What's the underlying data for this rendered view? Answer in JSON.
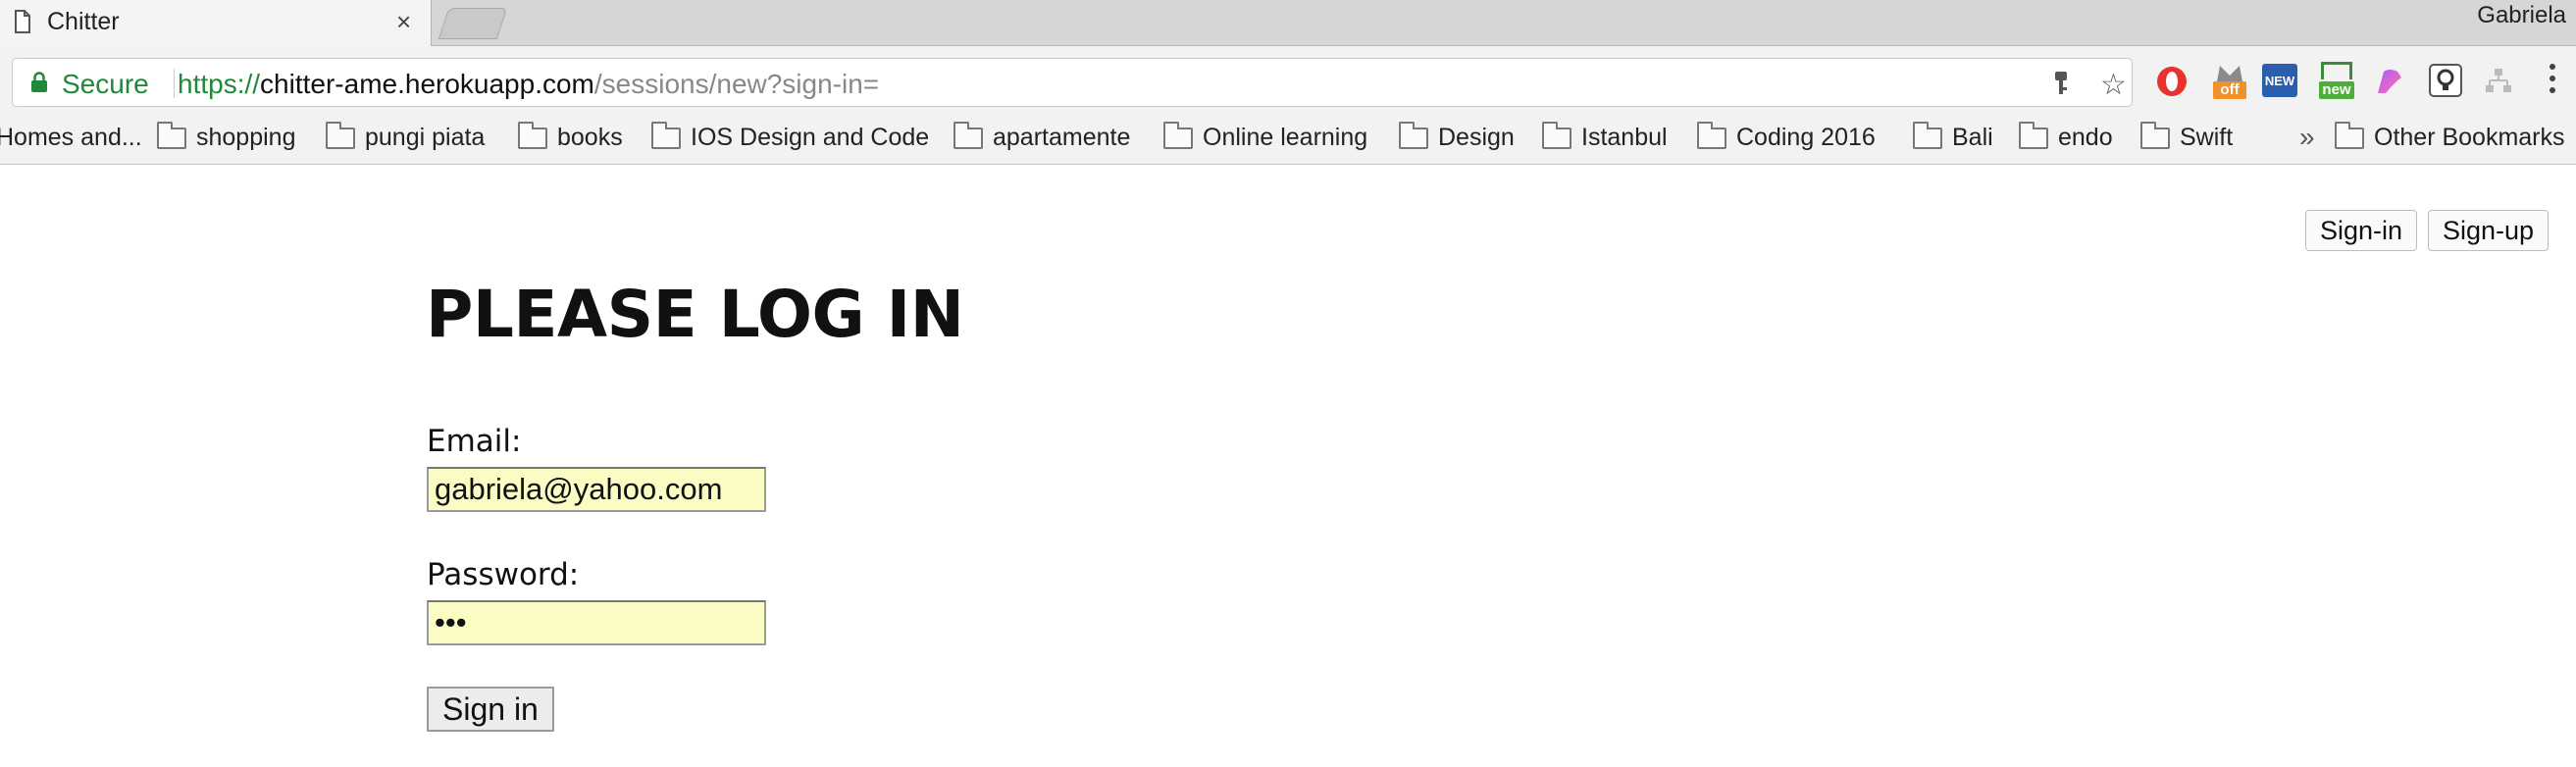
{
  "browser": {
    "tab_title": "Chitter",
    "tab_close": "×",
    "profile_name": "Gabriela",
    "secure_label": "Secure",
    "url_scheme": "https://",
    "url_host": "chitter-ame.herokuapp.com",
    "url_path": "/sessions/new?sign-in=",
    "accent_color": "#1e8a3a"
  },
  "extensions": [
    {
      "name": "opera-icon"
    },
    {
      "name": "off-badge",
      "label": "off"
    },
    {
      "name": "new-badge-blue",
      "label": "NEW"
    },
    {
      "name": "new-badge-green",
      "label": "new"
    },
    {
      "name": "paint-icon"
    },
    {
      "name": "lightbulb-icon"
    },
    {
      "name": "sitemap-icon"
    }
  ],
  "bookmarks": {
    "items": [
      "Homes and...",
      "shopping",
      "pungi piata",
      "books",
      "IOS Design and Code",
      "apartamente",
      "Online learning",
      "Design",
      "Istanbul",
      "Coding 2016",
      "Bali",
      "endo",
      "Swift"
    ],
    "overflow": "»",
    "other": "Other Bookmarks"
  },
  "page": {
    "signin_link": "Sign-in",
    "signup_link": "Sign-up",
    "heading": "PLEASE LOG IN",
    "email_label": "Email:",
    "email_value": "gabriela@yahoo.com",
    "password_label": "Password:",
    "password_value": "•••",
    "submit_label": "Sign in"
  }
}
